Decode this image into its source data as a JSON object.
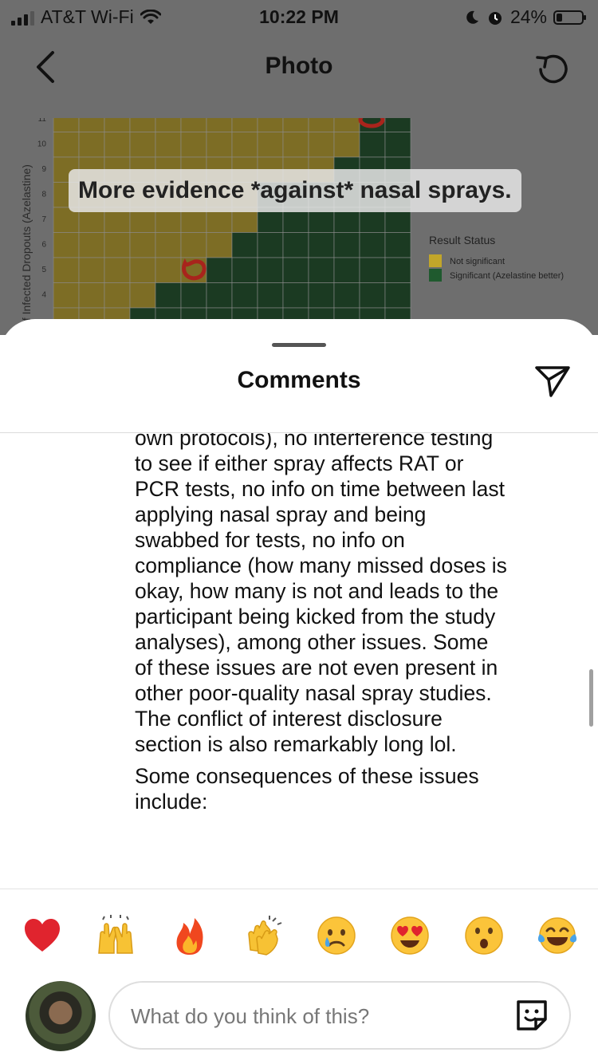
{
  "status_bar": {
    "carrier": "AT&T Wi-Fi",
    "time": "10:22 PM",
    "battery": "24%",
    "battery_level": 0.24
  },
  "nav": {
    "title": "Photo"
  },
  "photo": {
    "caption": "More evidence *against* nasal sprays.",
    "y_axis_label": "of Infected Dropouts (Azelastine)",
    "y_ticks": [
      "11",
      "10",
      "9",
      "8",
      "7",
      "6",
      "5",
      "4"
    ],
    "legend_title": "Result Status",
    "legend_items": [
      {
        "label": "Not significant",
        "color": "#c2a62a"
      },
      {
        "label": "Significant (Azelastine better)",
        "color": "#1f5a2e"
      }
    ]
  },
  "sheet": {
    "title": "Comments"
  },
  "comment": {
    "paragraph_1": "own protocols), no interference testing to see if either spray affects RAT or PCR tests, no info on time between last applying nasal spray and being swabbed for tests, no info on compliance (how many missed doses is okay, how many is not and leads to the participant being kicked from the study analyses), among other issues. Some of these issues are not even present in other poor-quality nasal spray studies. The conflict of interest disclosure section is also remarkably long lol.",
    "paragraph_2": "Some consequences of these issues include:"
  },
  "reactions": [
    {
      "name": "red-heart",
      "emoji": "❤️"
    },
    {
      "name": "raising-hands",
      "emoji": "🙌"
    },
    {
      "name": "fire",
      "emoji": "🔥"
    },
    {
      "name": "clapping-hands",
      "emoji": "👏"
    },
    {
      "name": "crying-face",
      "emoji": "😢"
    },
    {
      "name": "heart-eyes",
      "emoji": "😍"
    },
    {
      "name": "surprised-face",
      "emoji": "😮"
    },
    {
      "name": "tears-of-joy",
      "emoji": "😂"
    }
  ],
  "composer": {
    "placeholder": "What do you think of this?"
  },
  "colors": {
    "dim_overlay": "#6e6e6e",
    "chart_yellow": "#c2a62a",
    "chart_green": "#1f5a2e"
  }
}
